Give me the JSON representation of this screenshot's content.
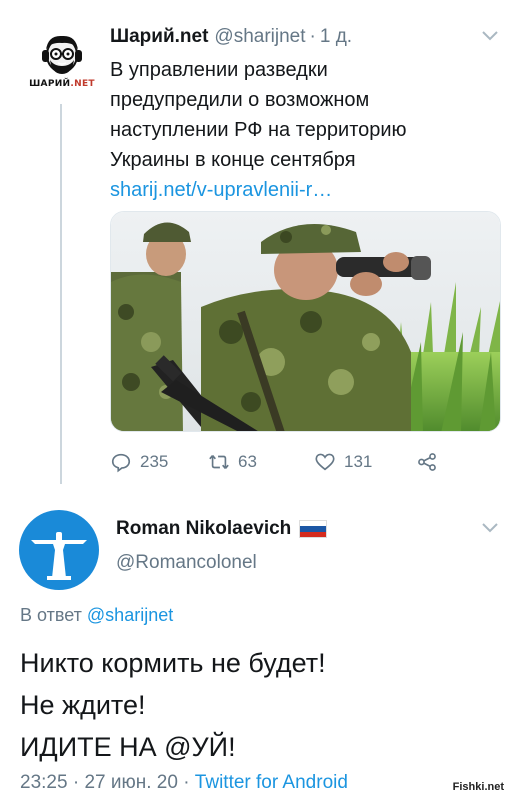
{
  "tweet1": {
    "author_name": "Шарий.net",
    "handle": "@sharijnet",
    "separator": "·",
    "time": "1 д.",
    "avatar_logo": {
      "main": "ШАРИЙ",
      "suffix": ".NET"
    },
    "text_lines": [
      "В управлении разведки",
      "предупредили о возможном",
      "наступлении РФ на территорию",
      "Украины в конце сентября"
    ],
    "link": "sharij.net/v-upravlenii-r…",
    "actions": {
      "replies": "235",
      "retweets": "63",
      "likes": "131"
    },
    "icons": {
      "menu": "chevron-down-icon",
      "reply": "reply-icon",
      "retweet": "retweet-icon",
      "like": "heart-icon",
      "share": "share-icon"
    }
  },
  "tweet2": {
    "author_name": "Roman Nikolaevich",
    "flag": "russia-flag-icon",
    "handle": "@Romancolonel",
    "reply_prefix": "В ответ",
    "reply_to": "@sharijnet",
    "text_lines": [
      "Никто кормить не будет!",
      "Не ждите!",
      "ИДИТЕ НА @УЙ!"
    ],
    "time": "23:25",
    "separator": "·",
    "date": "27 июн. 20",
    "source": "Twitter for Android"
  },
  "colors": {
    "link": "#1b95e0",
    "secondary": "#657786",
    "text": "#14171a",
    "avatar2_bg": "#1a8ad8"
  },
  "watermark": "Fishki.net"
}
